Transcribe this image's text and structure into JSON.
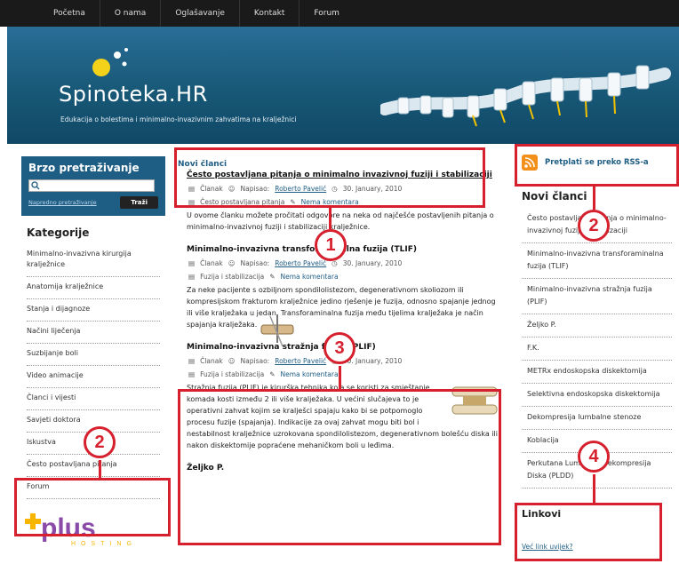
{
  "nav": {
    "items": [
      "Početna",
      "O nama",
      "Oglašavanje",
      "Kontakt",
      "Forum"
    ]
  },
  "header": {
    "site_title": "Spinoteka.HR",
    "tagline": "Edukacija o bolestima i minimalno-invazivnim zahvatima na kralježnici"
  },
  "left": {
    "search_title": "Brzo pretraživanje",
    "advanced_search": "Napredno pretraživanje",
    "search_button": "Traži",
    "categories_title": "Kategorije",
    "categories": [
      "Minimalno-invazivna kirurgija kralježnice",
      "Anatomija kralježnice",
      "Stanja i dijagnoze",
      "Načini liječenja",
      "Suzbijanje boli",
      "Video animacije",
      "Članci i vijesti",
      "Savjeti doktora",
      "Iskustva",
      "Često postavljana pitanja",
      "Forum"
    ],
    "sponsor": "plus",
    "sponsor_sub": "HOSTING"
  },
  "main": {
    "section_title": "Novi članci",
    "posts": [
      {
        "title": "Često postavljana pitanja o minimalno invazivnoj fuziji i stabilizaciji",
        "type": "Članak",
        "author_prefix": "Napisao:",
        "author": "Roberto Pavelić",
        "date": "30. January, 2010",
        "category": "Često postavljana pitanja",
        "comments": "Nema komentara",
        "excerpt": "U ovome članku možete pročitati odgovore na neka od najčešće postavljenih pitanja o minimalno-invazivnoj fuziji i stabilizaciji kralježnice."
      },
      {
        "title": "Minimalno-invazivna transforaminalna fuzija (TLIF)",
        "type": "Članak",
        "author_prefix": "Napisao:",
        "author": "Roberto Pavelić",
        "date": "30. January, 2010",
        "category": "Fuzija i stabilizacija",
        "comments": "Nema komentara",
        "excerpt": "Za neke pacijente s ozbiljnom spondilolistezom, degenerativnom skoliozom ili kompresijskom frakturom kralježnice jedino rješenje je fuzija, odnosno spajanje jednog ili više kralježaka u jedan. Transforaminalna fuzija među tijelima kralježaka je način spajanja kralježaka."
      },
      {
        "title": "Minimalno-invazivna stražnja fuzija (PLIF)",
        "type": "Članak",
        "author_prefix": "Napisao:",
        "author": "Roberto Pavelić",
        "date": "30. January, 2010",
        "category": "Fuzija i stabilizacija",
        "comments": "Nema komentara",
        "excerpt": "Stražnja fuzija (PLIF) je kirurška tehnika koja se koristi za smještanje komada kosti između 2 ili više kralježaka. U većini slučajeva to je operativni zahvat kojim se kralješci spajaju kako bi se potpomoglo procesu fuzije (spajanja). Indikacije za ovaj zahvat mogu biti bol i nestabilnost kralježnice uzrokovana spondilolistezom, degenerativnom bolešću diska ili nakon diskektomije popraćene mehaničkom boli u leđima."
      },
      {
        "title": "Željko P."
      }
    ]
  },
  "right": {
    "rss": "Pretplati se preko RSS-a",
    "new_title": "Novi članci",
    "new_items": [
      "Često postavljana pitanja o minimalno-invazivnoj fuziji i stabilizaciji",
      "Minimalno-invazivna transforaminalna fuzija (TLIF)",
      "Minimalno-invazivna stražnja fuzija (PLIF)",
      "Željko P.",
      "F.K.",
      "METRx endoskopska diskektomija",
      "Selektivna endoskopska diskektomija",
      "Dekompresija lumbalne stenoze",
      "Koblacija",
      "Perkutana Lumbalna Dekompresija Diska (PLDD)"
    ],
    "links_title": "Linkovi",
    "links_question": "Već link uvijek?"
  },
  "annotations": [
    "1",
    "2",
    "3",
    "2",
    "4"
  ],
  "colors": {
    "annotation": "#d6202d",
    "brand_blue": "#1e5d84",
    "header_bg": "#185877",
    "rss_orange": "#f39019"
  }
}
